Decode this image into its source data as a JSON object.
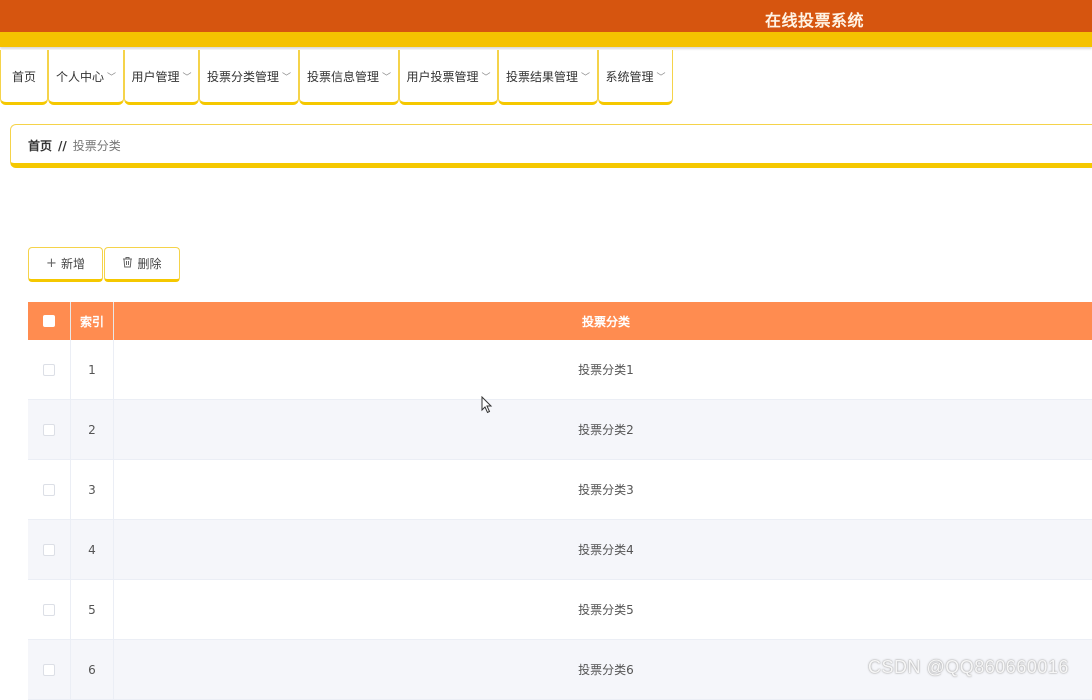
{
  "app": {
    "title": "在线投票系统"
  },
  "nav": {
    "items": [
      {
        "label": "首页",
        "chevron": ""
      },
      {
        "label": "个人中心",
        "chevron": "﹀"
      },
      {
        "label": "用户管理",
        "chevron": "﹀"
      },
      {
        "label": "投票分类管理",
        "chevron": "﹀"
      },
      {
        "label": "投票信息管理",
        "chevron": "﹀"
      },
      {
        "label": "用户投票管理",
        "chevron": "﹀"
      },
      {
        "label": "投票结果管理",
        "chevron": "﹀"
      },
      {
        "label": "系统管理",
        "chevron": "﹀"
      }
    ]
  },
  "breadcrumb": {
    "home": "首页",
    "separator": "//",
    "current": "投票分类"
  },
  "toolbar": {
    "add": {
      "icon": "+",
      "label": "新增"
    },
    "delete": {
      "icon": "🗑",
      "label": "删除"
    }
  },
  "table": {
    "headers": {
      "index": "索引",
      "category": "投票分类"
    },
    "rows": [
      {
        "index": "1",
        "category": "投票分类1"
      },
      {
        "index": "2",
        "category": "投票分类2"
      },
      {
        "index": "3",
        "category": "投票分类3"
      },
      {
        "index": "4",
        "category": "投票分类4"
      },
      {
        "index": "5",
        "category": "投票分类5"
      },
      {
        "index": "6",
        "category": "投票分类6"
      }
    ]
  },
  "watermark": "CSDN @QQ860660016",
  "colors": {
    "topbar": "#d6550f",
    "accent_yellow": "#f5c200",
    "table_header": "#ff8c50"
  }
}
